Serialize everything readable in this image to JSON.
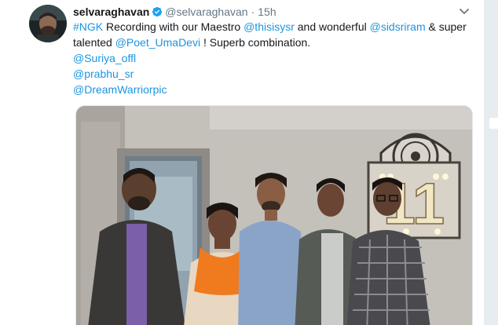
{
  "author": {
    "name": "selvaraghavan",
    "handle": "@selvaraghavan",
    "separator": "·",
    "time": "15h",
    "verified_icon": "verified-badge-icon",
    "avatar_icon": "avatar"
  },
  "menu": {
    "icon": "chevron-down-icon"
  },
  "tweet": {
    "line1": {
      "hashtag": "#NGK",
      "t1": " Recording with our Maestro ",
      "m1": "@thisisysr",
      "t2": " and wonderful ",
      "m2": "@sidsriram",
      "t3": " & super"
    },
    "line2": {
      "t1": "talented ",
      "m1": "@Poet_UmaDevi",
      "t2": " ! Superb combination."
    },
    "mentions": [
      "@Suriya_offl",
      "@prabhu_sr",
      "@DreamWarriorpic"
    ]
  },
  "media": {
    "type": "photo",
    "description_icon": "photo-image",
    "sign_text": "11"
  },
  "colors": {
    "link": "#1b95e0",
    "text": "#14171a",
    "secondary": "#657786",
    "background": "#e6ecf0"
  }
}
